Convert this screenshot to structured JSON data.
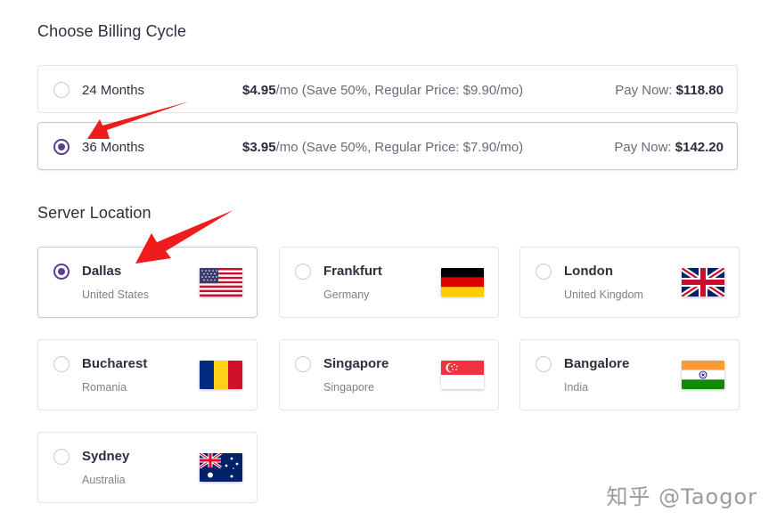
{
  "billing": {
    "title": "Choose Billing Cycle",
    "plans": [
      {
        "term": "24 Months",
        "price": "$4.95",
        "price_note": "/mo (Save 50%, Regular Price: $9.90/mo)",
        "pay_label": "Pay Now:",
        "pay_amount": "$118.80",
        "selected": false
      },
      {
        "term": "36 Months",
        "price": "$3.95",
        "price_note": "/mo (Save 50%, Regular Price: $7.90/mo)",
        "pay_label": "Pay Now:",
        "pay_amount": "$142.20",
        "selected": true
      }
    ]
  },
  "location": {
    "title": "Server Location",
    "items": [
      {
        "city": "Dallas",
        "country": "United States",
        "flag": "us-flag-icon",
        "selected": true
      },
      {
        "city": "Frankfurt",
        "country": "Germany",
        "flag": "germany-flag-icon",
        "selected": false
      },
      {
        "city": "London",
        "country": "United Kingdom",
        "flag": "uk-flag-icon",
        "selected": false
      },
      {
        "city": "Bucharest",
        "country": "Romania",
        "flag": "romania-flag-icon",
        "selected": false
      },
      {
        "city": "Singapore",
        "country": "Singapore",
        "flag": "singapore-flag-icon",
        "selected": false
      },
      {
        "city": "Bangalore",
        "country": "India",
        "flag": "india-flag-icon",
        "selected": false
      },
      {
        "city": "Sydney",
        "country": "Australia",
        "flag": "australia-flag-icon",
        "selected": false
      }
    ]
  },
  "annotations": {
    "arrow_color": "#ee1c1c",
    "accent": "#5a3f8e"
  },
  "watermark": "知乎 @Taogor"
}
